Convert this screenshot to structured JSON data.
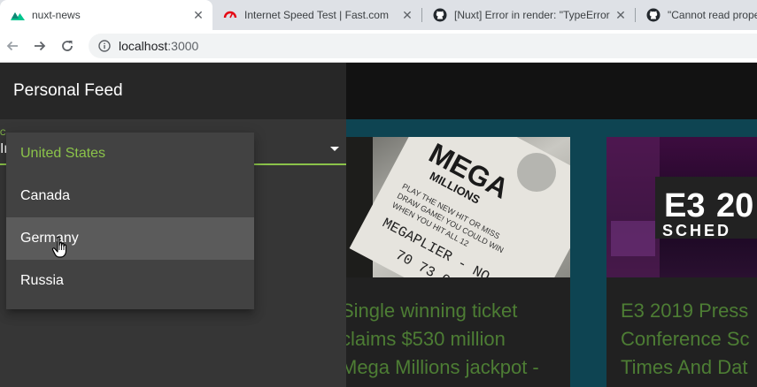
{
  "browser": {
    "tabs": [
      {
        "title": "nuxt-news",
        "icon": "nuxt-icon",
        "active": true
      },
      {
        "title": "Internet Speed Test | Fast.com",
        "icon": "fast-speedometer-icon",
        "active": false
      },
      {
        "title": "[Nuxt] Error in render: \"TypeError",
        "icon": "github-icon",
        "active": false
      },
      {
        "title": "\"Cannot read prope",
        "icon": "github-icon",
        "active": false
      }
    ],
    "url_host": "localhost",
    "url_port": ":3000"
  },
  "drawer": {
    "title": "Personal Feed",
    "select": {
      "label": "C",
      "value": "United States",
      "value_fragment": "Ir"
    },
    "menu": {
      "items": [
        {
          "label": "United States",
          "selected": true
        },
        {
          "label": "Canada",
          "selected": false
        },
        {
          "label": "Germany",
          "hover": true
        },
        {
          "label": "Russia",
          "selected": false
        }
      ]
    }
  },
  "cards": [
    {
      "headline_lines": [
        "Single winning ticket",
        "claims $530 million",
        "Mega Millions jackpot -"
      ],
      "image": "mega-millions-lottery-ticket-photo"
    },
    {
      "headline_lines": [
        "E3 2019 Press",
        "Conference Sc",
        "Times And Dat"
      ],
      "image": "e3-2019-schedule-photo"
    }
  ],
  "colors": {
    "accent": "#8bc34a",
    "headline": "#4d7d34",
    "page_bg": "#0e4452",
    "drawer_bg": "#363636"
  }
}
